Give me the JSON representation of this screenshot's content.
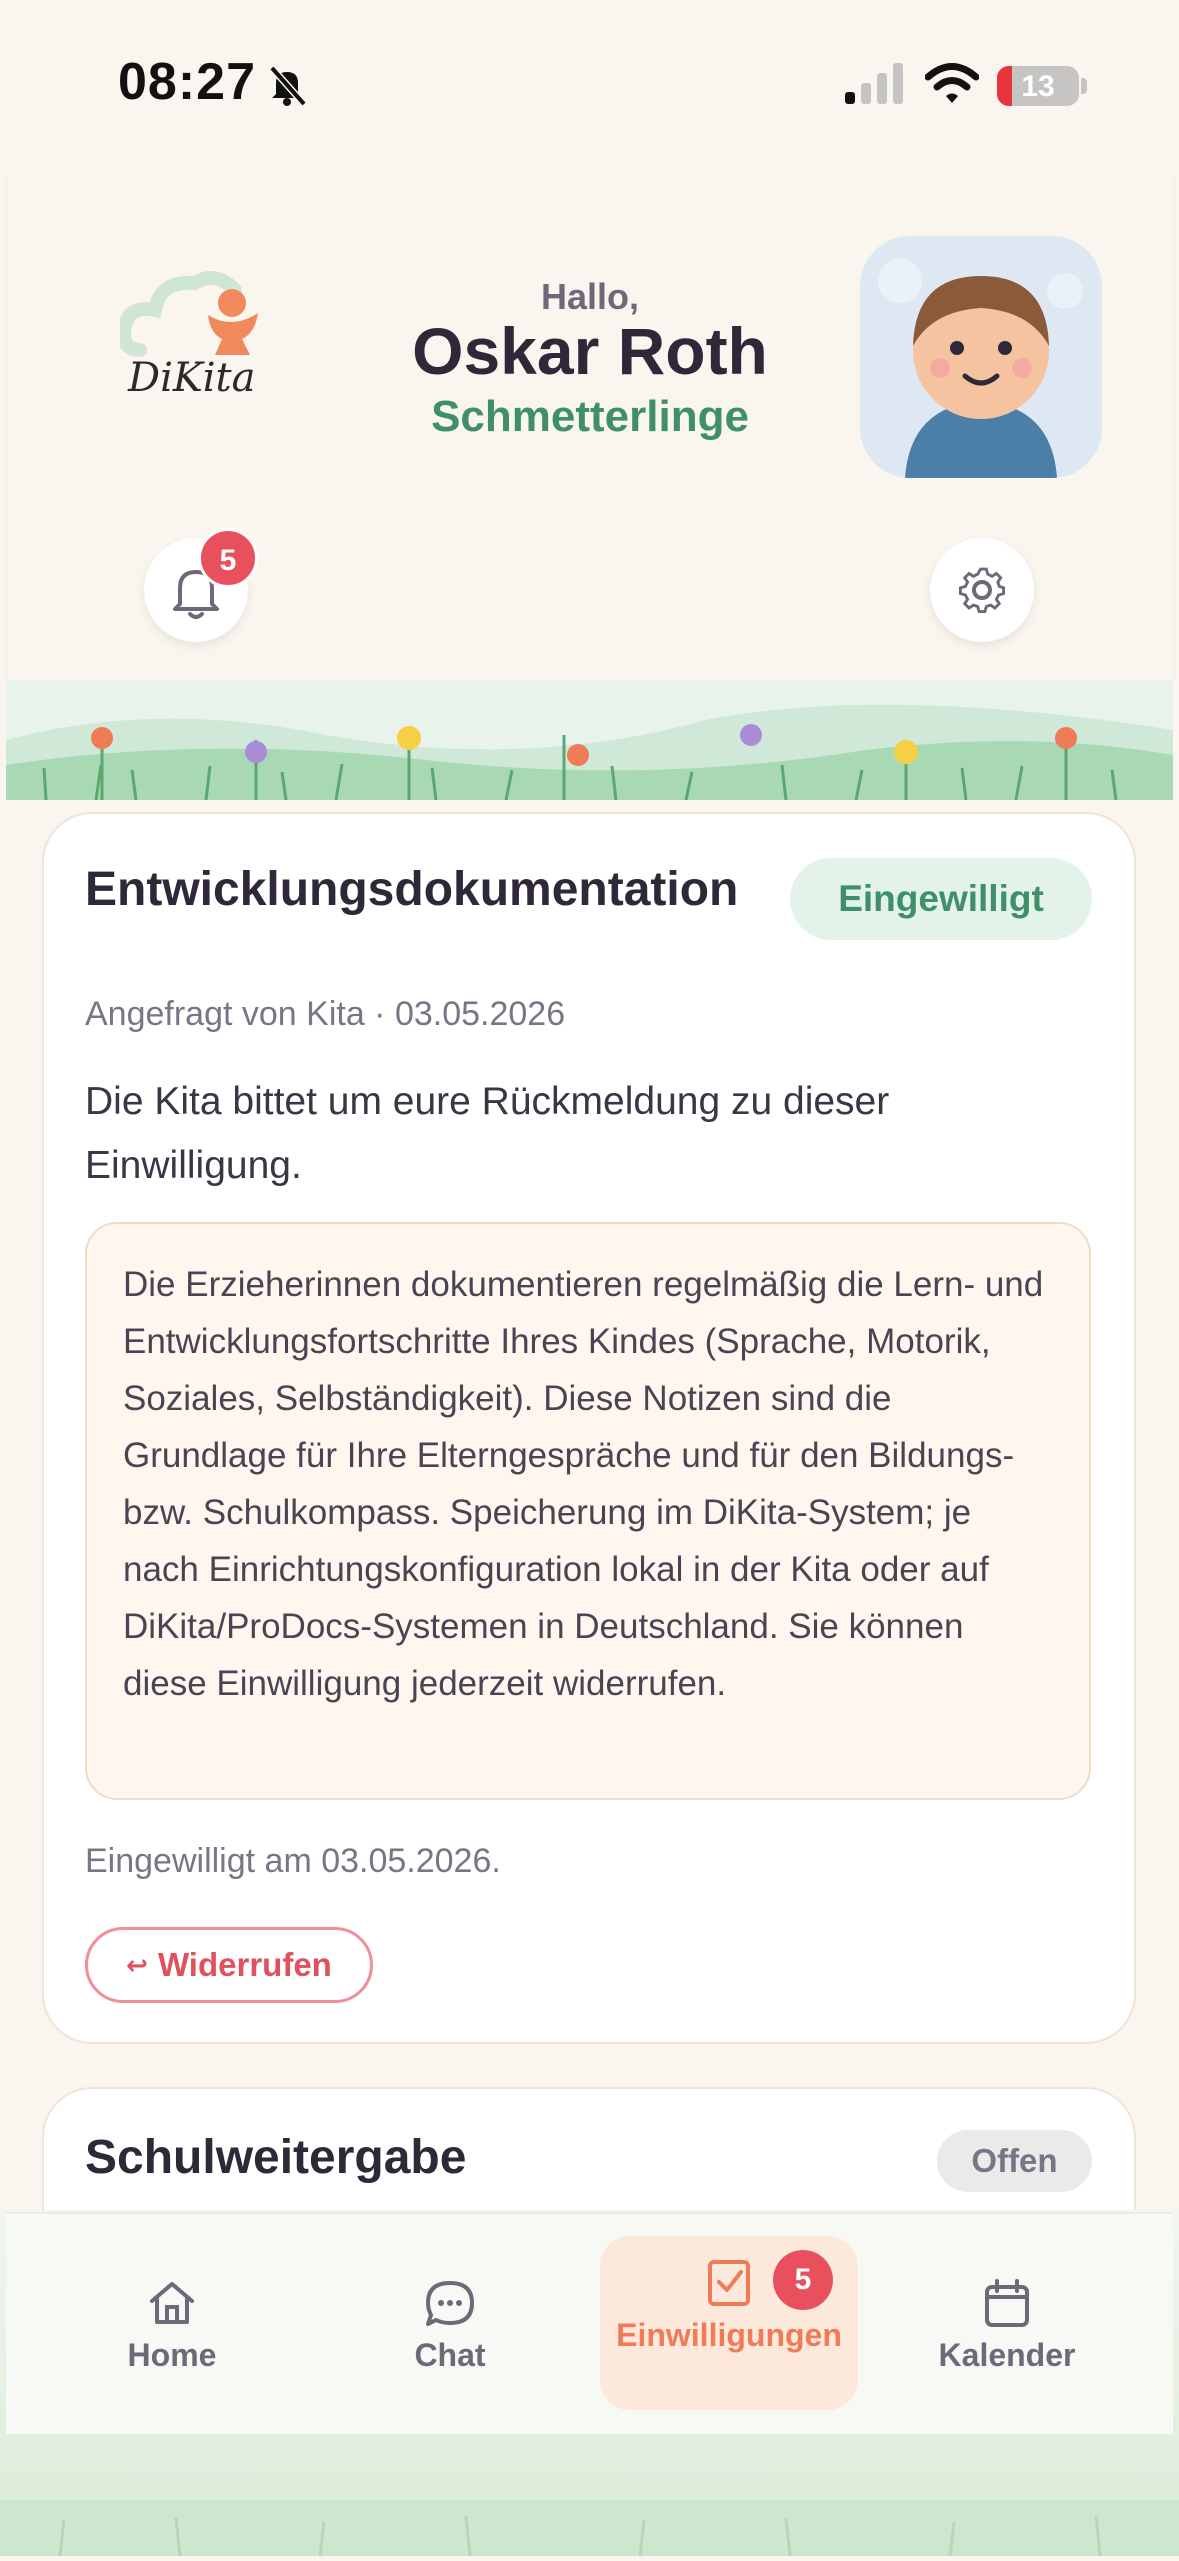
{
  "status_bar": {
    "time": "08:27",
    "battery": "13"
  },
  "header": {
    "logo_text": "DiKita",
    "greeting": "Hallo,",
    "user_name": "Oskar Roth",
    "group": "Schmetterlinge",
    "notification_count": "5"
  },
  "consent_card": {
    "title": "Entwicklungsdokumentation",
    "status": "Eingewilligt",
    "meta": "Angefragt von Kita · 03.05.2026",
    "intro": "Die Kita bittet um eure Rückmeldung zu dieser Einwilligung.",
    "details": "Die Erzieherinnen dokumentieren regelmäßig die Lern- und Entwicklungsfortschritte Ihres Kindes (Sprache, Motorik, Soziales, Selbständigkeit). Diese Notizen sind die Grundlage für Ihre Elterngespräche und für den Bildungs- bzw. Schulkompass. Speicherung im DiKita-System; je nach Einrichtungskonfiguration lokal in der Kita oder auf DiKita/ProDocs-Systemen in Deutschland. Sie können diese Einwilligung jederzeit widerrufen.",
    "consent_date": "Eingewilligt am 03.05.2026.",
    "revoke_label": "Widerrufen"
  },
  "second_card": {
    "title": "Schulweitergabe",
    "status": "Offen"
  },
  "nav": {
    "home": "Home",
    "chat": "Chat",
    "consents": "Einwilligungen",
    "calendar": "Kalender",
    "consents_badge": "5"
  },
  "colors": {
    "accent": "#ef7b57",
    "green": "#3f8f6a",
    "badge": "#e8505e"
  }
}
